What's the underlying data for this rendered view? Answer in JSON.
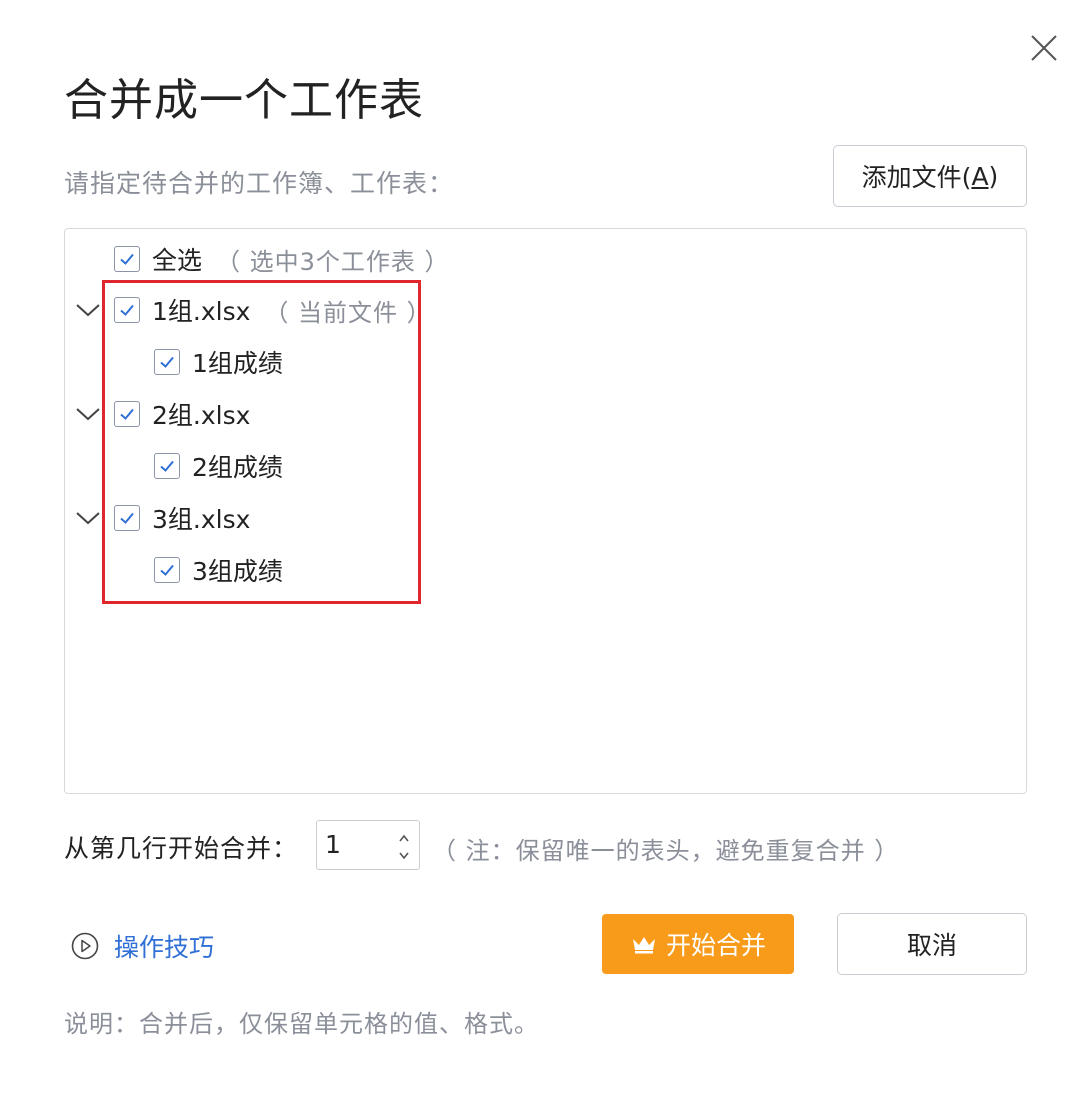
{
  "dialog": {
    "title": "合并成一个工作表",
    "close_icon": "close-icon"
  },
  "instruction": "请指定待合并的工作簿、工作表：",
  "add_file": {
    "label_pre": "添加文件(",
    "accelerator": "A",
    "label_post": ")"
  },
  "tree": {
    "select_all": {
      "label": "全选",
      "note": "（ 选中3个工作表 ）",
      "checked": true
    },
    "files": [
      {
        "name": "1组.xlsx",
        "note": "（ 当前文件 ）",
        "checked": true,
        "expanded": true,
        "sheets": [
          {
            "name": "1组成绩",
            "checked": true
          }
        ]
      },
      {
        "name": "2组.xlsx",
        "note": "",
        "checked": true,
        "expanded": true,
        "sheets": [
          {
            "name": "2组成绩",
            "checked": true
          }
        ]
      },
      {
        "name": "3组.xlsx",
        "note": "",
        "checked": true,
        "expanded": true,
        "sheets": [
          {
            "name": "3组成绩",
            "checked": true
          }
        ]
      }
    ],
    "highlight_color": "#e0262d"
  },
  "start_row": {
    "label": "从第几行开始合并：",
    "value": "1",
    "note": "（ 注：保留唯一的表头，避免重复合并 ）"
  },
  "actions": {
    "tips_label": "操作技巧",
    "start_label": "开始合并",
    "start_color": "#f89b1a",
    "cancel_label": "取消"
  },
  "footnote": "说明：合并后，仅保留单元格的值、格式。",
  "colors": {
    "link": "#2f6fd6",
    "muted": "#8a8f99"
  }
}
